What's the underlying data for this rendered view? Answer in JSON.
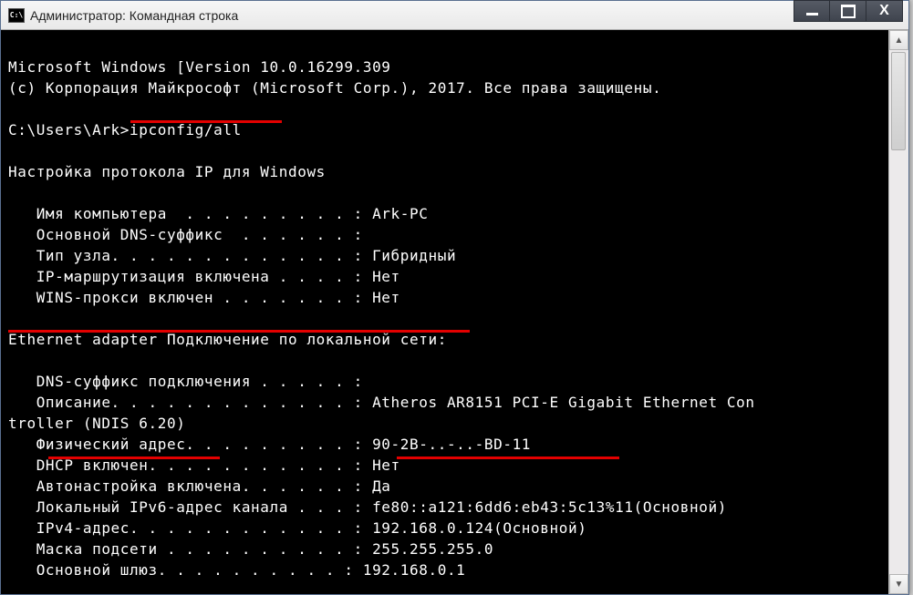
{
  "window": {
    "title": "Администратор: Командная строка"
  },
  "terminal": {
    "line1": "Microsoft Windows [Version 10.0.16299.309",
    "line2": "(c) Корпорация Майкрософт (Microsoft Corp.), 2017. Все права защищены.",
    "blank": "",
    "prompt_prefix": "C:\\Users\\Ark>",
    "command": "ipconfig/all",
    "header": "Настройка протокола IP для Windows",
    "cfg": {
      "hostname": "   Имя компьютера  . . . . . . . . . : Ark-PC",
      "dnssuffix": "   Основной DNS-суффикс  . . . . . . :",
      "nodetype": "   Тип узла. . . . . . . . . . . . . : Гибридный",
      "iprouting": "   IP-маршрутизация включена . . . . : Нет",
      "winsproxy": "   WINS-прокси включен . . . . . . . : Нет"
    },
    "adapter_header": "Ethernet adapter Подключение по локальной сети:",
    "adapter": {
      "conn_dns": "   DNS-суффикс подключения . . . . . :",
      "desc1": "   Описание. . . . . . . . . . . . . : Atheros AR8151 PCI-E Gigabit Ethernet Con",
      "desc2": "troller (NDIS 6.20)",
      "physaddr": "   Физический адрес. . . . . . . . . : 90-2B-..-..-BD-11",
      "dhcp": "   DHCP включен. . . . . . . . . . . : Нет",
      "autoconf": "   Автонастройка включена. . . . . . : Да",
      "ipv6": "   Локальный IPv6-адрес канала . . . : fe80::a121:6dd6:eb43:5c13%11(Основной)",
      "ipv4": "   IPv4-адрес. . . . . . . . . . . . : 192.168.0.124(Основной)",
      "mask": "   Маска подсети . . . . . . . . . . : 255.255.255.0",
      "gateway": "   Основной шлюз. . . . . . . . . . : 192.168.0.1"
    }
  }
}
